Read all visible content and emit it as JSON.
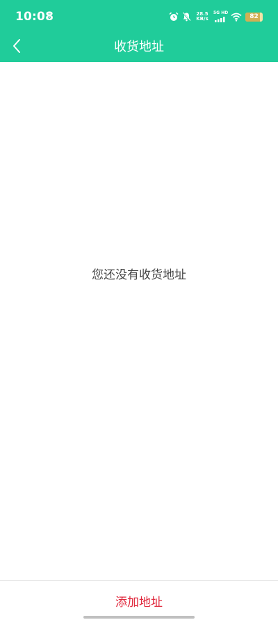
{
  "status_bar": {
    "time": "10:08",
    "net_speed_value": "28.5",
    "net_speed_unit": "KB/s",
    "network_label": "5G HD",
    "battery_level": "82"
  },
  "nav": {
    "title": "收货地址",
    "back_icon": "chevron-left-icon"
  },
  "content": {
    "empty_message": "您还没有收货地址"
  },
  "bottom": {
    "add_label": "添加地址"
  },
  "colors": {
    "header_bg": "#20cc9a",
    "accent_red": "#e0283c",
    "text_gray": "#444444"
  }
}
